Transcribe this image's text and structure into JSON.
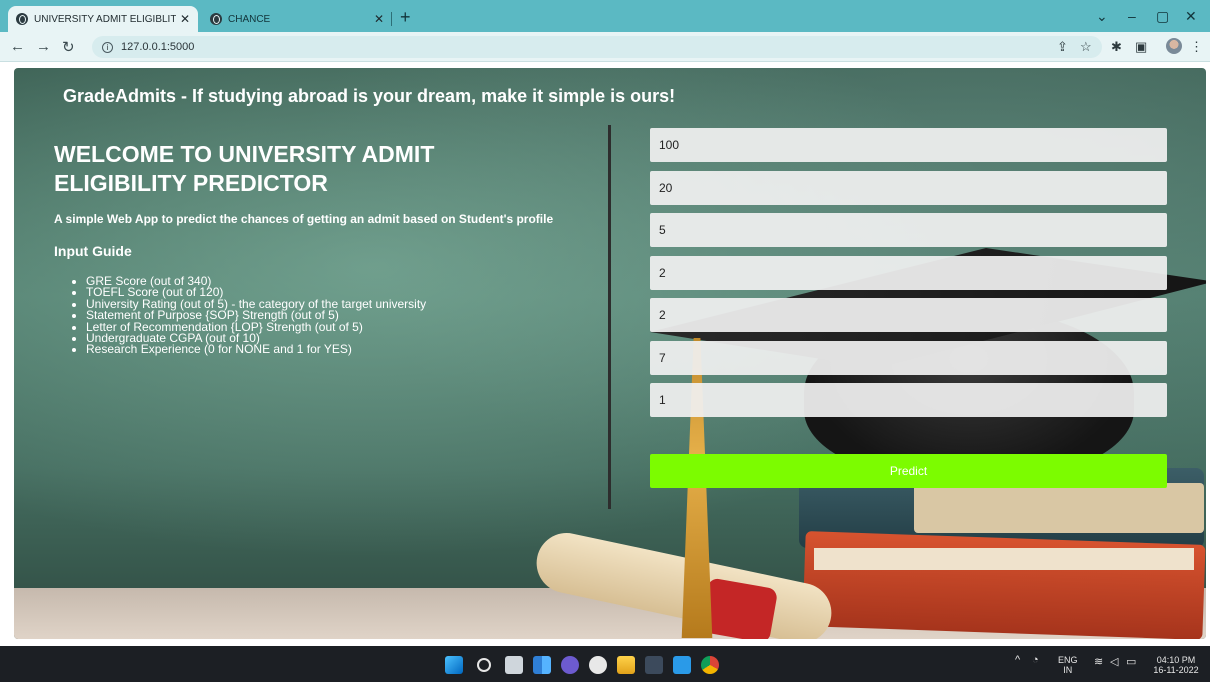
{
  "browser": {
    "tabs": [
      {
        "title": "UNIVERSITY ADMIT ELIGIBLITY P",
        "active": true
      },
      {
        "title": "CHANCE",
        "active": false
      }
    ],
    "new_tab": "+",
    "url": "127.0.0.1:5000"
  },
  "page": {
    "site_title": "GradeAdmits - If studying abroad is your dream, make it simple is ours!",
    "welcome": "WELCOME TO UNIVERSITY ADMIT ELIGIBILITY PREDICTOR",
    "subtitle": "A simple Web App to predict the chances of getting an admit based on Student's profile",
    "guide_title": "Input Guide",
    "guide_items": [
      "GRE Score (out of 340)",
      "TOEFL Score (out of 120)",
      "University Rating (out of 5) - the category of the target university",
      "Statement of Purpose {SOP} Strength (out of 5)",
      "Letter of Recommendation {LOP} Strength (out of 5)",
      "Undergraduate CGPA (out of 10)",
      "Research Experience (0 for NONE and 1 for YES)"
    ],
    "fields": [
      "100",
      "20",
      "5",
      "2",
      "2",
      "7",
      "1"
    ],
    "predict_label": "Predict"
  },
  "taskbar": {
    "lang": "ENG",
    "region": "IN",
    "time": "04:10 PM",
    "date": "16-11-2022"
  },
  "colors": {
    "tab_bar": "#5bb9c3",
    "predict_button": "#7cfc00",
    "taskbar": "#1c1f24"
  }
}
